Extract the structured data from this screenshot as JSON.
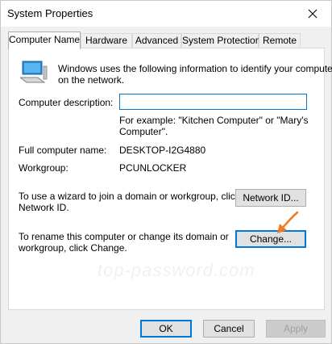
{
  "window": {
    "title": "System Properties"
  },
  "tabs": [
    {
      "label": "Computer Name",
      "active": true
    },
    {
      "label": "Hardware",
      "active": false
    },
    {
      "label": "Advanced",
      "active": false
    },
    {
      "label": "System Protection",
      "active": false
    },
    {
      "label": "Remote",
      "active": false
    }
  ],
  "panel": {
    "intro": "Windows uses the following information to identify your computer on the network.",
    "intro_line1": "Windows uses the following information to identify your computer",
    "intro_line2": "on the network.",
    "description_label": "Computer description:",
    "description_value": "",
    "example_line1": "For example: \"Kitchen Computer\" or \"Mary's",
    "example_line2": "Computer\".",
    "full_name_label": "Full computer name:",
    "full_name_value": "DESKTOP-I2G4880",
    "workgroup_label": "Workgroup:",
    "workgroup_value": "PCUNLOCKER",
    "network_text_line1": "To use a wizard to join a domain or workgroup, click",
    "network_text_line2": "Network ID.",
    "network_id_button": "Network ID...",
    "rename_text_line1": "To rename this computer or change its domain or",
    "rename_text_line2": "workgroup, click Change.",
    "change_button": "Change...",
    "watermark": "top-password.com"
  },
  "footer": {
    "ok_button": "OK",
    "cancel_button": "Cancel",
    "apply_button": "Apply"
  },
  "icons": {
    "close": "close-icon",
    "computer": "computer-icon",
    "arrow": "arrow-annotation"
  },
  "colors": {
    "focus_blue": "#0078d7",
    "arrow_orange": "#f37a1f",
    "dialog_bg": "#f0f0f0"
  }
}
